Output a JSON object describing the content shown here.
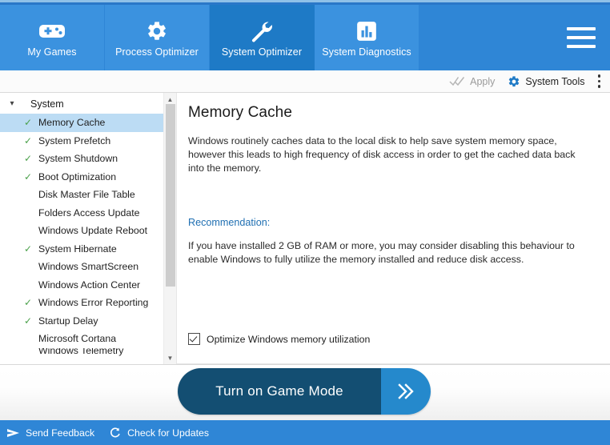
{
  "theme": {
    "brand_blue": "#2f86d6",
    "tab_blue": "#3b92df",
    "tab_active_blue": "#1e7ac6",
    "selection_blue": "#bcdcf4",
    "check_green": "#4aa14a",
    "link_blue": "#1f6fb2",
    "button_dark": "#134e72",
    "button_arrow": "#2589cc"
  },
  "tabs": [
    {
      "label": "My Games",
      "icon": "gamepad-icon",
      "active": false
    },
    {
      "label": "Process Optimizer",
      "icon": "gear-icon",
      "active": false
    },
    {
      "label": "System Optimizer",
      "icon": "wrench-icon",
      "active": true
    },
    {
      "label": "System Diagnostics",
      "icon": "bar-chart-icon",
      "active": false
    }
  ],
  "menu_button": {
    "icon": "hamburger-icon"
  },
  "toolbar": {
    "apply_label": "Apply",
    "apply_icon": "double-check-icon",
    "system_tools_label": "System Tools",
    "system_tools_icon": "gear-icon",
    "overflow_icon": "kebab-menu-icon"
  },
  "sidebar": {
    "group_label": "System",
    "group_chevron": "chevron-down-icon",
    "scroll_up_icon": "chevron-up-icon",
    "scroll_down_icon": "chevron-down-icon",
    "items": [
      {
        "label": "Memory Cache",
        "checked": true,
        "selected": true
      },
      {
        "label": "System Prefetch",
        "checked": true,
        "selected": false
      },
      {
        "label": "System Shutdown",
        "checked": true,
        "selected": false
      },
      {
        "label": "Boot Optimization",
        "checked": true,
        "selected": false
      },
      {
        "label": "Disk Master File Table",
        "checked": false,
        "selected": false
      },
      {
        "label": "Folders Access Update",
        "checked": false,
        "selected": false
      },
      {
        "label": "Windows Update Reboot",
        "checked": false,
        "selected": false
      },
      {
        "label": "System Hibernate",
        "checked": true,
        "selected": false
      },
      {
        "label": "Windows SmartScreen",
        "checked": false,
        "selected": false
      },
      {
        "label": "Windows Action Center",
        "checked": false,
        "selected": false
      },
      {
        "label": "Windows Error Reporting",
        "checked": true,
        "selected": false
      },
      {
        "label": "Startup Delay",
        "checked": true,
        "selected": false
      },
      {
        "label": "Microsoft Cortana",
        "checked": false,
        "selected": false
      },
      {
        "label": "Windows Telemetry",
        "checked": false,
        "selected": false
      }
    ]
  },
  "detail": {
    "title": "Memory Cache",
    "description": "Windows routinely caches data to the local disk to help save system memory space, however this leads to high frequency of disk access in order to get the cached data back into the memory.",
    "recommendation_title": "Recommendation:",
    "recommendation_body": "If you have installed 2 GB of RAM or more, you may consider disabling this behaviour to enable Windows to fully utilize the memory installed and reduce disk access.",
    "option_label": "Optimize Windows memory utilization",
    "option_checked": true
  },
  "action": {
    "game_mode_label": "Turn on Game Mode",
    "arrow_icon": "double-chevron-right-icon"
  },
  "footer": {
    "items": [
      {
        "label": "Send Feedback",
        "icon": "send-arrow-icon"
      },
      {
        "label": "Check for Updates",
        "icon": "refresh-icon"
      }
    ]
  }
}
